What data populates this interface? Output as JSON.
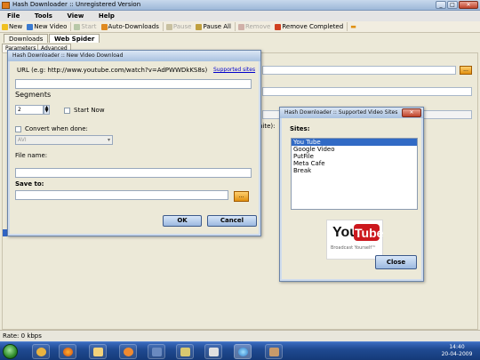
{
  "window": {
    "title": "Hash Downloader :: Unregistered Version"
  },
  "menu": [
    "File",
    "Tools",
    "View",
    "Help"
  ],
  "toolbar": {
    "new": "New",
    "new_video": "New Video",
    "start": "Start",
    "auto_downloads": "Auto-Downloads",
    "pause": "Pause",
    "pause_all": "Pause All",
    "remove": "Remove",
    "remove_completed": "Remove Completed"
  },
  "tabs": {
    "downloads": "Downloads",
    "web_spider": "Web Spider"
  },
  "subtabs": {
    "parameters": "Parameters",
    "advanced": "Advanced"
  },
  "background": {
    "site_suffix": "nite):"
  },
  "download_dialog": {
    "title": "Hash Downloader :: New Video Download",
    "url_label": "URL (e.g: http://www.youtube.com/watch?v=AdPWWDkKS8s)",
    "supported_sites_link": "Supported sites",
    "url_value": "",
    "segments_label": "Segments",
    "segments_value": "2",
    "start_now_label": "Start Now",
    "convert_label": "Convert when done:",
    "convert_format": "AVI",
    "file_name_label": "File name:",
    "save_to_label": "Save to:",
    "browse_label": "...",
    "ok": "OK",
    "cancel": "Cancel"
  },
  "sites_dialog": {
    "title": "Hash Downloader :: Supported Video Sites",
    "sites_label": "Sites:",
    "sites": [
      "You Tube",
      "Google Video",
      "PutFile",
      "Meta Cafe",
      "Break"
    ],
    "selected_index": 0,
    "logo_word_1": "You",
    "logo_word_2": "Tube",
    "logo_tagline": "Broadcast Yourself™",
    "close": "Close"
  },
  "status": {
    "rate": "Rate:  0 kbps"
  },
  "taskbar": {
    "time": "14:40",
    "date": "20-04-2009"
  },
  "colors": {
    "accent": "#316ac5",
    "youtube_red": "#cc181e",
    "browse_orange": "#e09010"
  },
  "icons": {
    "new": "new-file-icon",
    "new_video": "new-video-icon",
    "start": "play-icon",
    "auto_downloads": "auto-download-icon",
    "pause": "pause-icon",
    "pause_all": "pause-all-icon",
    "remove": "remove-icon",
    "remove_completed": "remove-completed-icon"
  }
}
